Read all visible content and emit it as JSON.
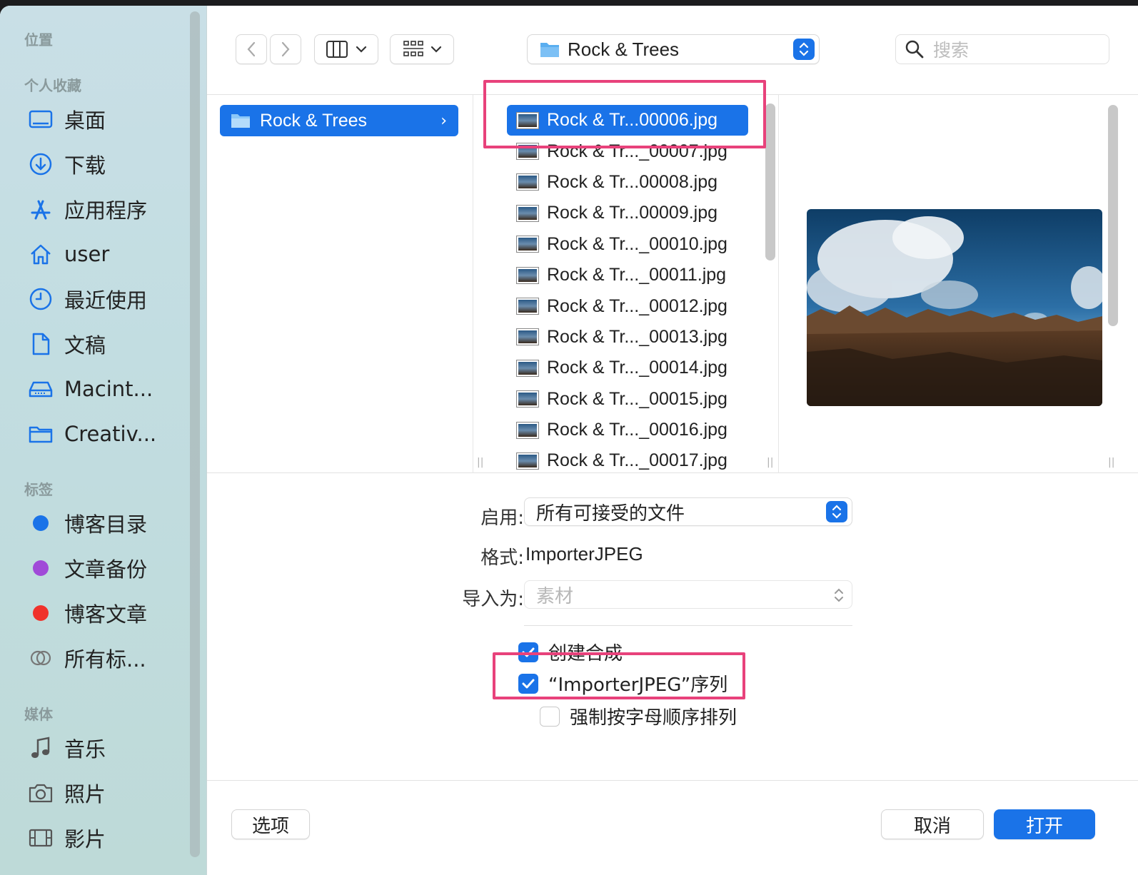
{
  "sidebar": {
    "sections": {
      "locations": "位置",
      "favorites": "个人收藏",
      "tags": "标签",
      "media": "媒体"
    },
    "favorites": [
      {
        "label": "桌面",
        "icon": "desktop-icon"
      },
      {
        "label": "下载",
        "icon": "download-icon"
      },
      {
        "label": "应用程序",
        "icon": "applications-icon"
      },
      {
        "label": "user",
        "icon": "home-icon"
      },
      {
        "label": "最近使用",
        "icon": "clock-icon"
      },
      {
        "label": "文稿",
        "icon": "document-icon"
      },
      {
        "label": "Macint...",
        "icon": "drive-icon"
      },
      {
        "label": "Creativ...",
        "icon": "folder-icon"
      }
    ],
    "tags": [
      {
        "label": "博客目录",
        "color": "#1a73e8"
      },
      {
        "label": "文章备份",
        "color": "#a04ad8"
      },
      {
        "label": "博客文章",
        "color": "#f0322b"
      },
      {
        "label": "所有标...",
        "icon": "all-tags-icon"
      }
    ],
    "media": [
      {
        "label": "音乐",
        "icon": "music-icon"
      },
      {
        "label": "照片",
        "icon": "camera-icon"
      },
      {
        "label": "影片",
        "icon": "film-icon"
      }
    ]
  },
  "toolbar": {
    "path": "Rock & Trees",
    "search_placeholder": "搜索"
  },
  "browser": {
    "column1_selected": "Rock & Trees",
    "files": [
      "Rock & Tr...00006.jpg",
      "Rock & Tr..._00007.jpg",
      "Rock & Tr...00008.jpg",
      "Rock & Tr...00009.jpg",
      "Rock & Tr..._00010.jpg",
      "Rock & Tr..._00011.jpg",
      "Rock & Tr..._00012.jpg",
      "Rock & Tr..._00013.jpg",
      "Rock & Tr..._00014.jpg",
      "Rock & Tr..._00015.jpg",
      "Rock & Tr..._00016.jpg",
      "Rock & Tr..._00017.jpg"
    ],
    "selected_index": 0
  },
  "options": {
    "enable_label": "启用:",
    "enable_value": "所有可接受的文件",
    "format_label": "格式:",
    "format_value": "ImporterJPEG",
    "import_as_label": "导入为:",
    "import_as_value": "素材",
    "create_comp": {
      "label": "创建合成",
      "checked": true
    },
    "sequence": {
      "label": "“ImporterJPEG”序列",
      "checked": true
    },
    "force_alpha": {
      "label": "强制按字母顺序排列",
      "checked": false
    }
  },
  "footer": {
    "options_button": "选项",
    "cancel_button": "取消",
    "open_button": "打开"
  },
  "colors": {
    "accent": "#1a73e8",
    "highlight": "#e8427b"
  }
}
